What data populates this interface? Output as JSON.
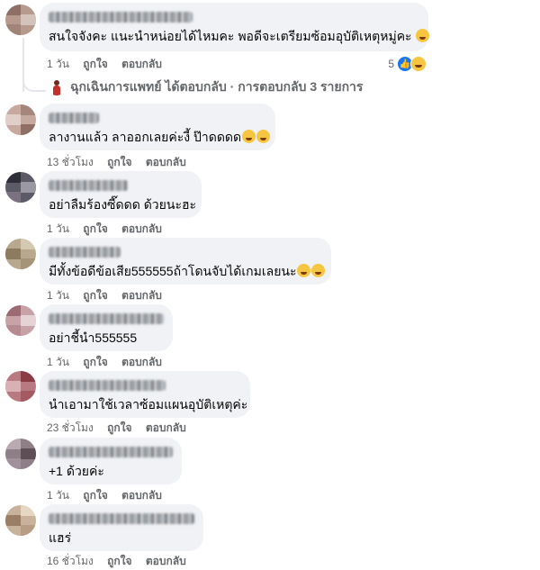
{
  "comments": [
    {
      "text": "สนใจจังคะ แนะนำหน่อยได้ไหมคะ พอดีจะเตรียมซ้อมอุบัติเหตุหมู่คะ",
      "emojis": [
        "grin-icon"
      ],
      "time": "1 วัน",
      "like": "ถูกใจ",
      "reply": "ตอบกลับ"
    },
    {
      "text": "ลางานแล้ว ลาออกเลยค่ะงี้ ป๊าดดดด",
      "emojis": [
        "rofl-icon",
        "rofl-icon"
      ],
      "time": "13 ชั่วโมง",
      "like": "ถูกใจ",
      "reply": "ตอบกลับ"
    },
    {
      "text": "อย่าลืมร้องซี๊ดดด ด้วยนะฮะ",
      "emojis": [],
      "time": "1 วัน",
      "like": "ถูกใจ",
      "reply": "ตอบกลับ"
    },
    {
      "text": "มีทั้งข้อดีข้อเสีย555555ถ้าโดนจับได้เกมเลยนะ",
      "emojis": [
        "rofl-icon",
        "rofl-icon"
      ],
      "time": "1 วัน",
      "like": "ถูกใจ",
      "reply": "ตอบกลับ"
    },
    {
      "text": "อย่าชี้นำ555555",
      "emojis": [],
      "time": "1 วัน",
      "like": "ถูกใจ",
      "reply": "ตอบกลับ"
    },
    {
      "text": "นำเอามาใช้เวลาซ้อมแผนอุบัติเหตุค่ะ",
      "emojis": [],
      "time": "23 ชั่วโมง",
      "like": "ถูกใจ",
      "reply": "ตอบกลับ"
    },
    {
      "text": "+1 ด้วยค่ะ",
      "emojis": [],
      "time": "1 วัน",
      "like": "ถูกใจ",
      "reply": "ตอบกลับ"
    },
    {
      "text": "แฮร่",
      "emojis": [],
      "time": "16 ชั่วโมง",
      "like": "ถูกใจ",
      "reply": "ตอบกลับ"
    }
  ],
  "first_reactions": {
    "count": "5",
    "icons": [
      "like-icon",
      "haha-icon"
    ]
  },
  "reply_summary": {
    "text": "ฉุกเฉินการแพทย์ ได้ตอบกลับ · การตอบกลับ 3 รายการ"
  },
  "colors": {
    "bubble": "#f0f2f5",
    "meta": "#65676b",
    "like_blue": "#1877f2"
  }
}
